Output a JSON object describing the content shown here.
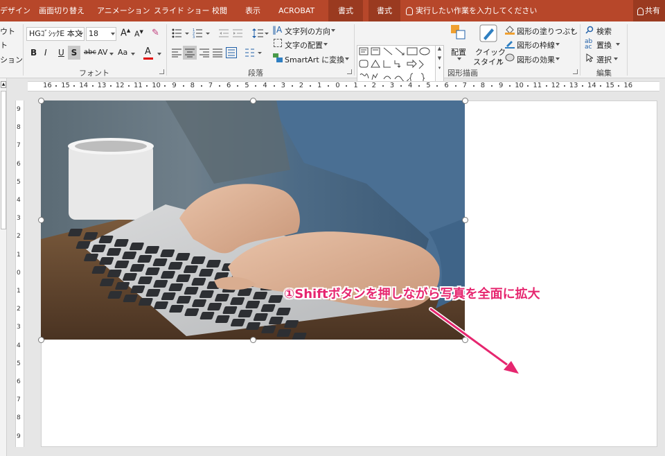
{
  "tabs": [
    {
      "label": "デザイン"
    },
    {
      "label": "画面切り替え"
    },
    {
      "label": "アニメーション"
    },
    {
      "label": "スライド ショー"
    },
    {
      "label": "校閲"
    },
    {
      "label": "表示"
    },
    {
      "label": "ACROBAT"
    },
    {
      "label": "書式"
    },
    {
      "label": "書式"
    }
  ],
  "tell_me": "実行したい作業を入力してください",
  "share": "共有",
  "left_cut": {
    "layout": "ウト",
    "reset": "ト",
    "section": "ション"
  },
  "font": {
    "name": "HGｺﾞｼｯｸE 本文",
    "size": "18",
    "group_label": "フォント",
    "bold": "B",
    "italic": "I",
    "underline": "U",
    "shadow": "S",
    "strike": "abc",
    "spacing": "AV",
    "case": "Aa",
    "color": "A"
  },
  "paragraph": {
    "group_label": "段落",
    "text_direction": "文字列の方向",
    "align_text": "文字の配置",
    "smartart": "SmartArt に変換"
  },
  "drawing": {
    "group_label": "図形描画",
    "arrange": "配置",
    "quick_style_1": "クイック",
    "quick_style_2": "スタイル",
    "fill": "図形の塗りつぶし",
    "outline": "図形の枠線",
    "effects": "図形の効果"
  },
  "editing": {
    "group_label": "編集",
    "find": "検索",
    "replace": "置換",
    "select": "選択"
  },
  "ruler_labels": [
    "16",
    "15",
    "14",
    "13",
    "12",
    "11",
    "10",
    "9",
    "8",
    "7",
    "6",
    "5",
    "4",
    "3",
    "2",
    "1",
    "0",
    "1",
    "2",
    "3",
    "4",
    "5",
    "6",
    "7",
    "8",
    "9",
    "10",
    "11",
    "12",
    "13",
    "14",
    "15",
    "16"
  ],
  "vruler_labels": [
    "9",
    "8",
    "7",
    "6",
    "5",
    "4",
    "3",
    "2",
    "1",
    "0",
    "1",
    "2",
    "3",
    "4",
    "5",
    "6",
    "7",
    "8",
    "9"
  ],
  "annotation": "①Shiftボタンを押しながら写真を全面に拡大",
  "colors": {
    "accent": "#b7472a",
    "annotation": "#e6266f"
  }
}
